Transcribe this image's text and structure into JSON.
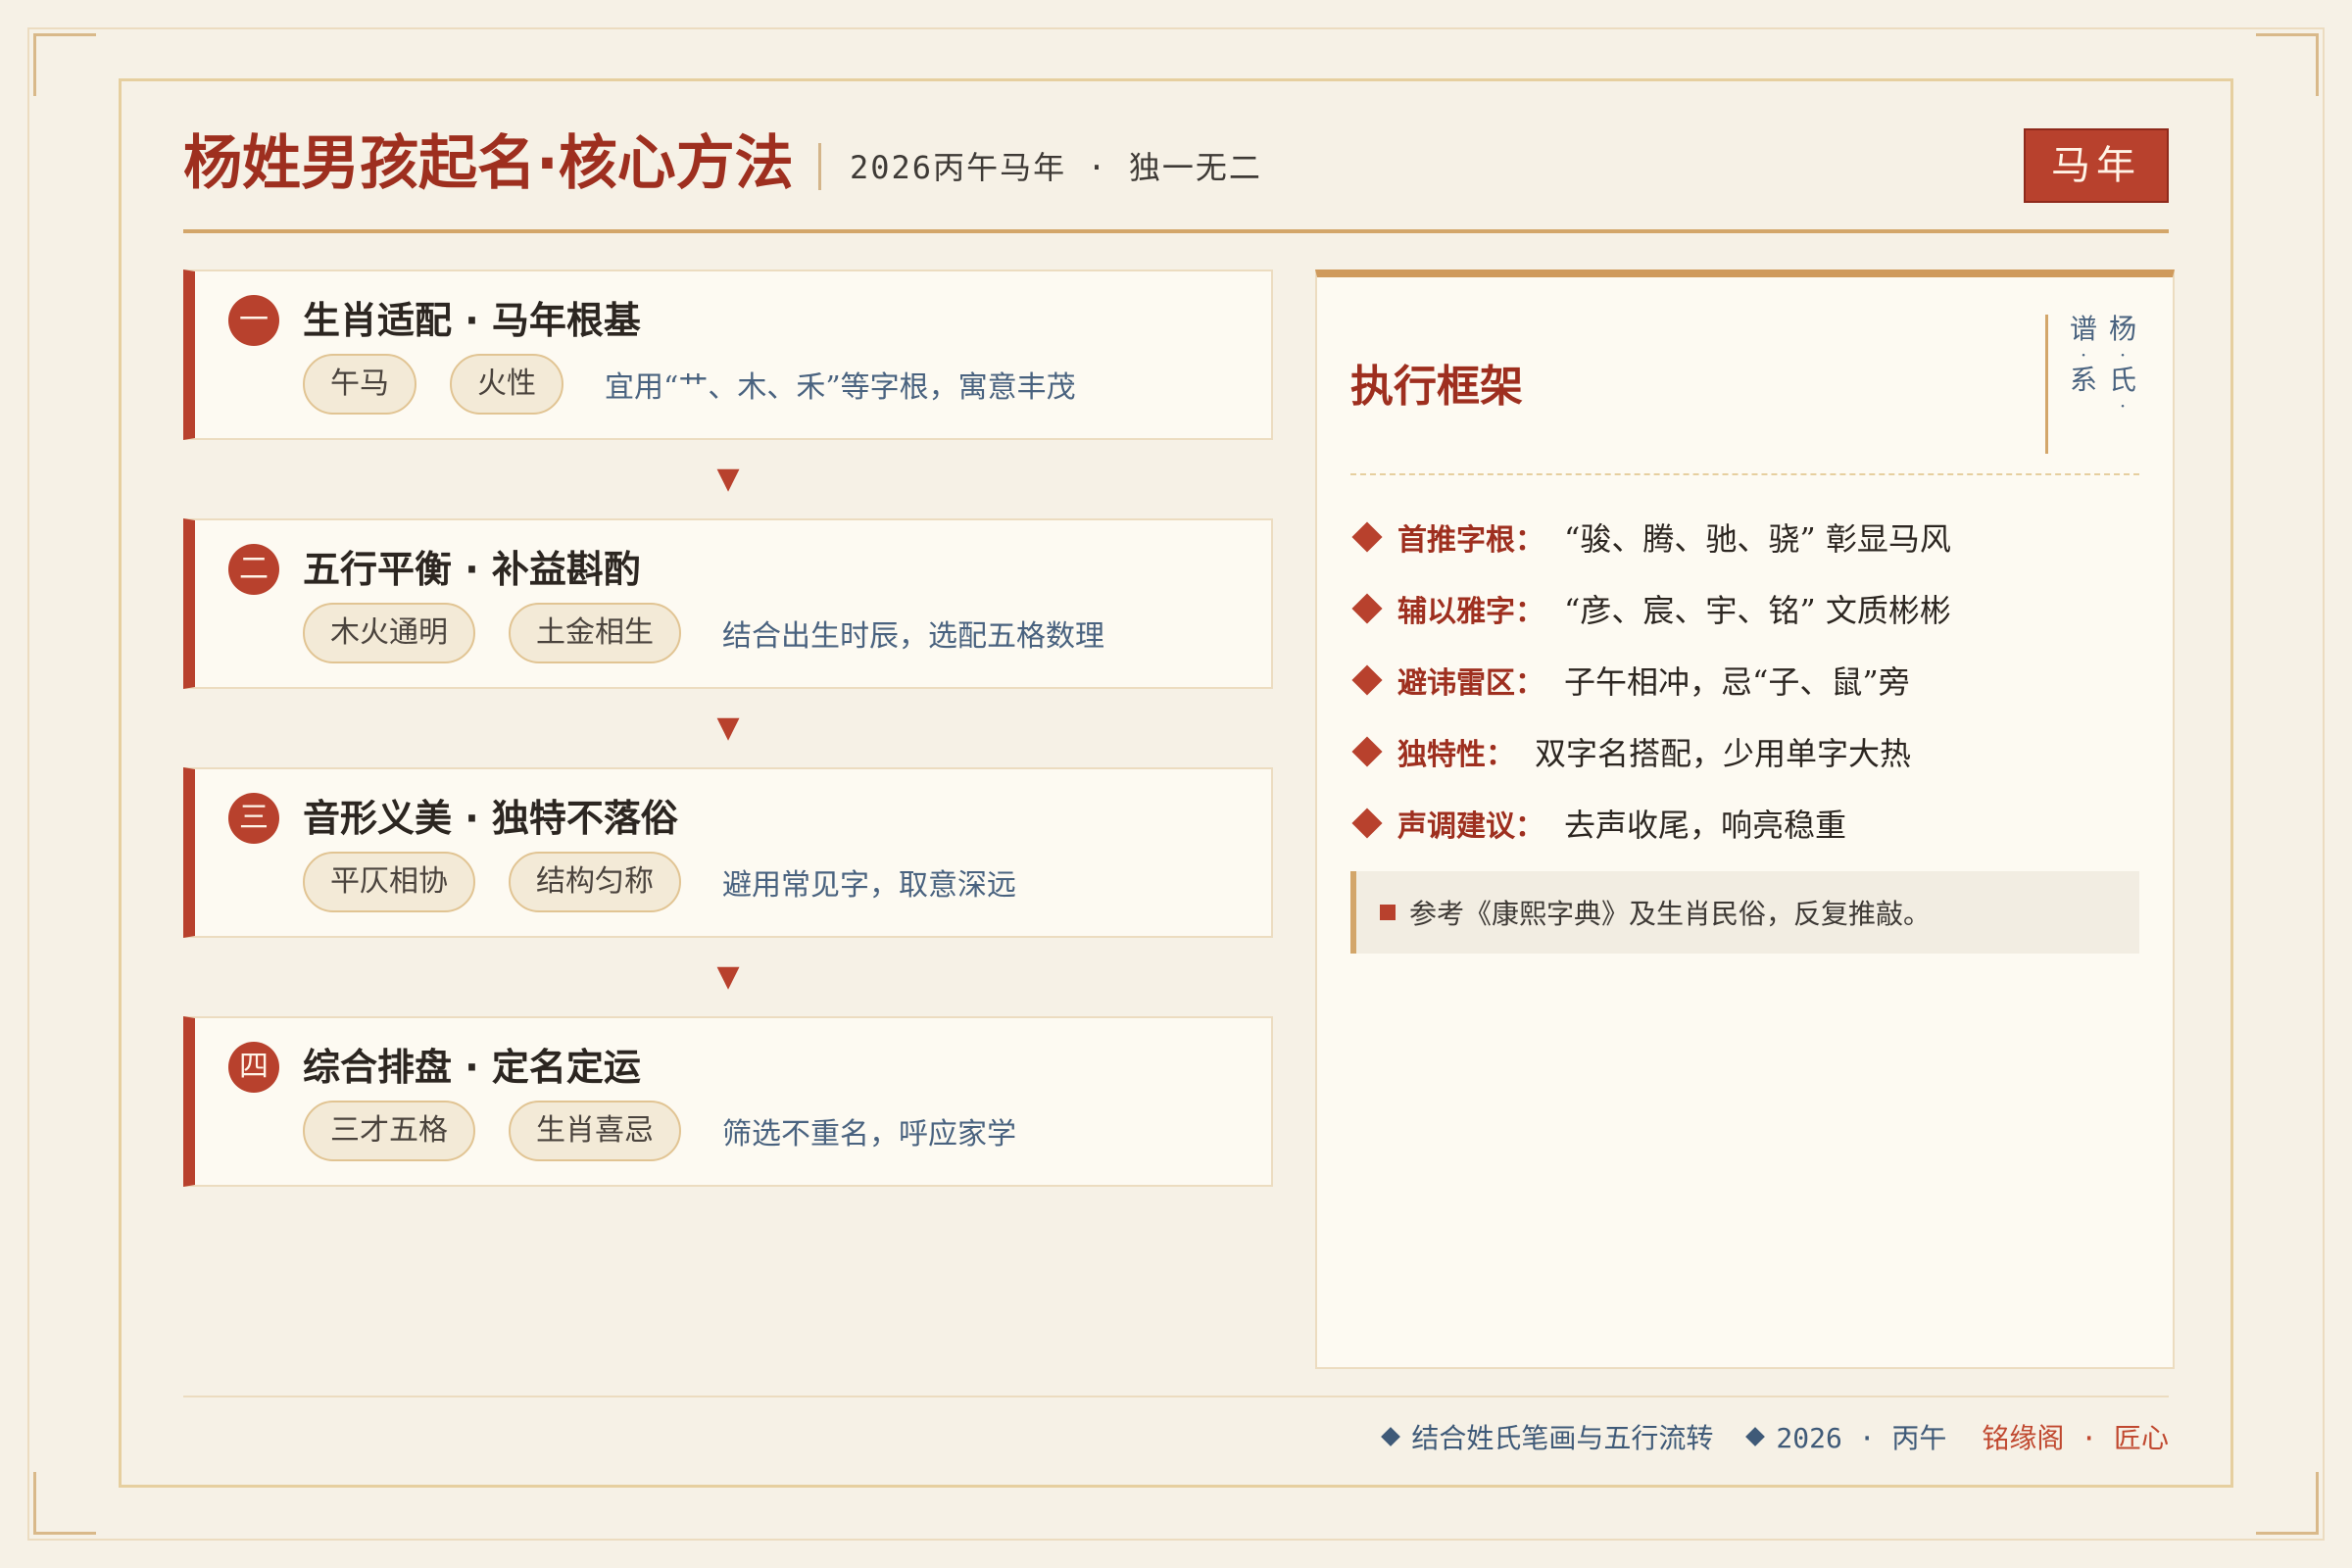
{
  "header": {
    "title": "杨姓男孩起名·核心方法",
    "subtitle": "2026丙午马年 · 独一无二",
    "badge": "马年"
  },
  "steps": [
    {
      "num": "一",
      "title": "生肖适配 · 马年根基",
      "tags": [
        "午马",
        "火性"
      ],
      "desc": "宜用“艹、木、禾”等字根，寓意丰茂"
    },
    {
      "num": "二",
      "title": "五行平衡 · 补益斟酌",
      "tags": [
        "木火通明",
        "土金相生"
      ],
      "desc": "结合出生时辰，选配五格数理"
    },
    {
      "num": "三",
      "title": "音形义美 · 独特不落俗",
      "tags": [
        "平仄相协",
        "结构匀称"
      ],
      "desc": "避用常见字，取意深远"
    },
    {
      "num": "四",
      "title": "综合排盘 · 定名定运",
      "tags": [
        "三才五格",
        "生肖喜忌"
      ],
      "desc": "筛选不重名，呼应家学"
    }
  ],
  "arrow": "▼",
  "panel": {
    "title": "执行框架",
    "seal_col1": [
      "杨",
      "氏"
    ],
    "seal_col2": [
      "谱",
      "系"
    ],
    "seal_dot": "·",
    "rules": [
      {
        "label": "首推字根：",
        "text": "“骏、腾、驰、骁” 彰显马风"
      },
      {
        "label": "辅以雅字：",
        "text": "“彦、宸、宇、铭” 文质彬彬"
      },
      {
        "label": "避讳雷区：",
        "text": "子午相冲，忌“子、鼠”旁"
      },
      {
        "label": "独特性：",
        "text": "双字名搭配，少用单字大热"
      },
      {
        "label": "声调建议：",
        "text": "去声收尾，响亮稳重"
      }
    ],
    "note": "参考《康熙字典》及生肖民俗，反复推敲。"
  },
  "footer": {
    "item1": "结合姓氏笔画与五行流转",
    "item2": "2026 · 丙午",
    "brand": "铭缘阁 · 匠心"
  },
  "colors": {
    "accent": "#b8412d",
    "title": "#9e2f1f",
    "gold": "#d3a66a",
    "text_blue": "#49627f",
    "background": "#f6f1e6"
  }
}
